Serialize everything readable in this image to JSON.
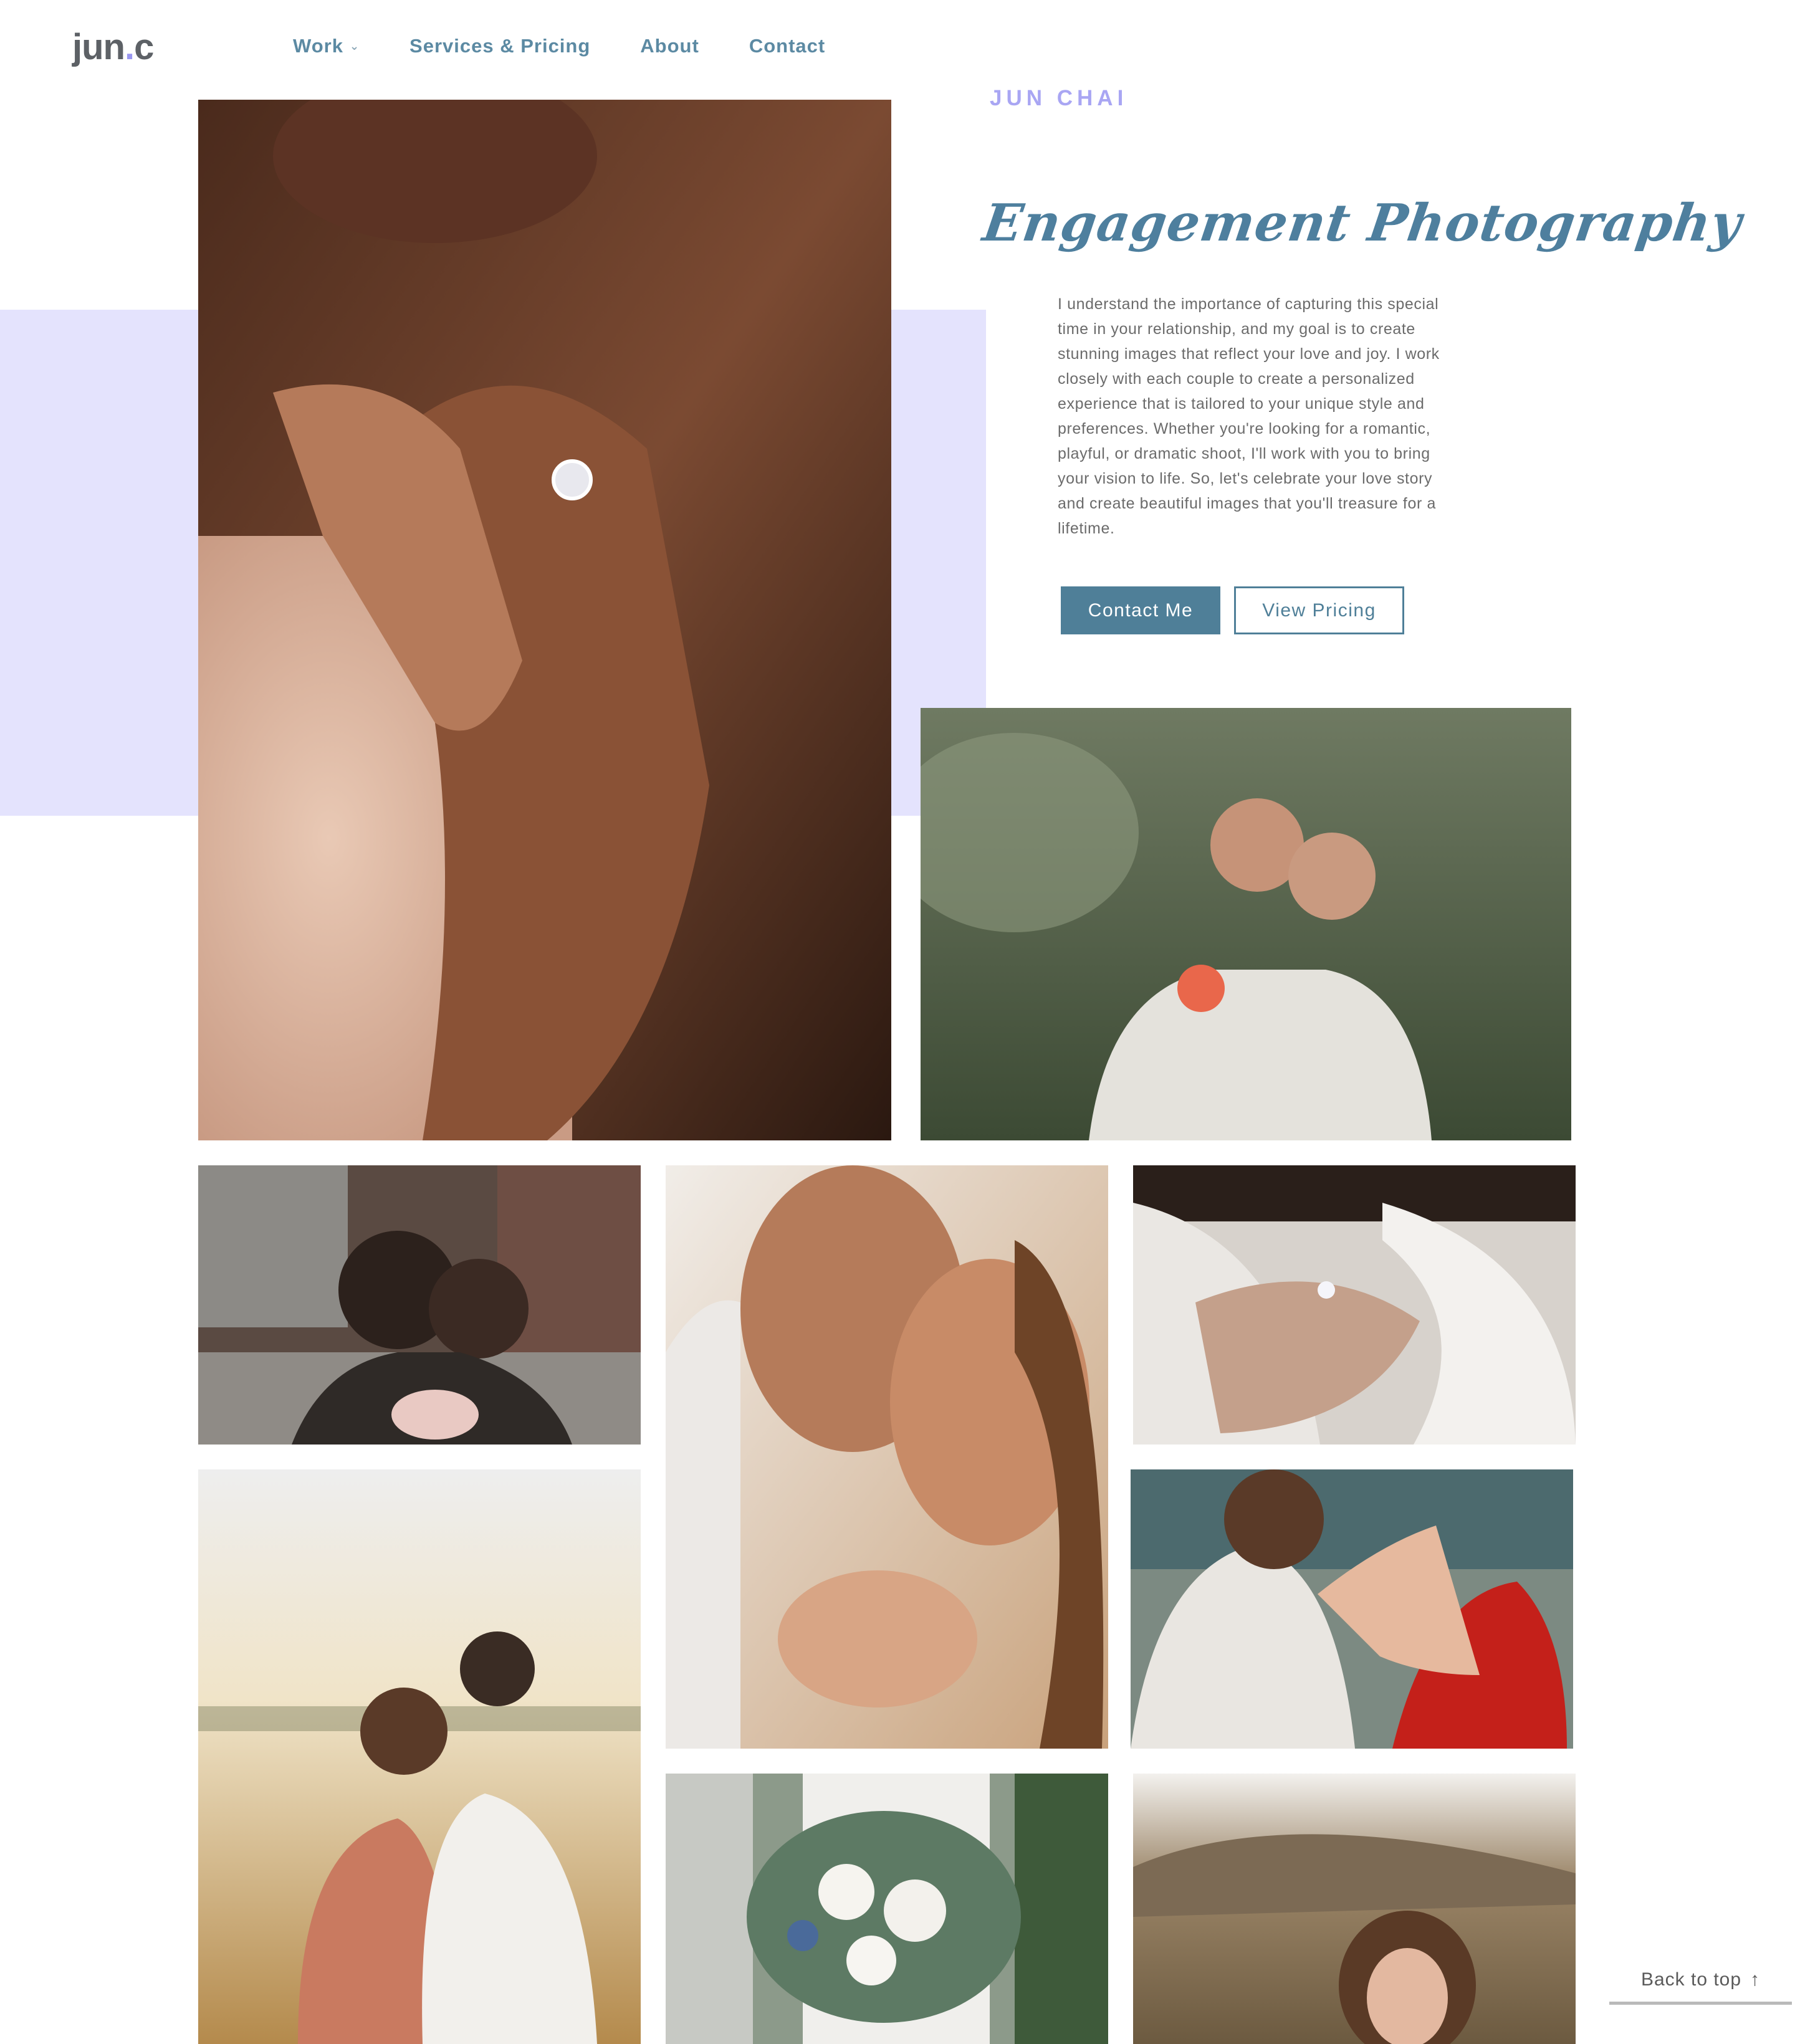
{
  "header": {
    "logo_main": "jun",
    "logo_dot": ".",
    "logo_end": "c",
    "nav": [
      {
        "label": "Work",
        "has_dropdown": true
      },
      {
        "label": "Services & Pricing"
      },
      {
        "label": "About"
      },
      {
        "label": "Contact"
      }
    ]
  },
  "hero": {
    "brand_name": "JUN CHAI",
    "title": "Engagement Photography",
    "intro": "I understand the importance of capturing this special time in your relationship, and my goal is to create stunning images that reflect your love and joy. I work closely with each couple to create a personalized experience that is tailored to your unique style and preferences. Whether you're looking for a romantic, playful, or dramatic shoot, I'll work with you to bring your vision to life. So, let's celebrate your love story and create beautiful images that you'll treasure for a lifetime.",
    "primary_button": "Contact Me",
    "secondary_button": "View Pricing"
  },
  "gallery": {
    "photos": [
      {
        "name": "ring-hands-closeup",
        "icon": "photo-image"
      },
      {
        "name": "couple-piggyback",
        "icon": "photo-image"
      },
      {
        "name": "couple-kissing-rooftop",
        "icon": "photo-image"
      },
      {
        "name": "couple-foreheads-touching",
        "icon": "photo-image"
      },
      {
        "name": "ring-lace-sleeve",
        "icon": "photo-image"
      },
      {
        "name": "couple-field-sunset",
        "icon": "photo-image"
      },
      {
        "name": "ring-hand-red-nails",
        "icon": "photo-image"
      },
      {
        "name": "bridal-bouquet",
        "icon": "photo-image"
      },
      {
        "name": "woman-in-grass",
        "icon": "photo-image"
      }
    ]
  },
  "footer": {
    "back_to_top": "Back to top",
    "back_to_top_icon": "arrow-up-icon"
  },
  "colors": {
    "accent": "#4f7f98",
    "nav": "#5c8aa3",
    "lavender": "#e4e3fd",
    "brand_purple": "#a9a6f3"
  }
}
